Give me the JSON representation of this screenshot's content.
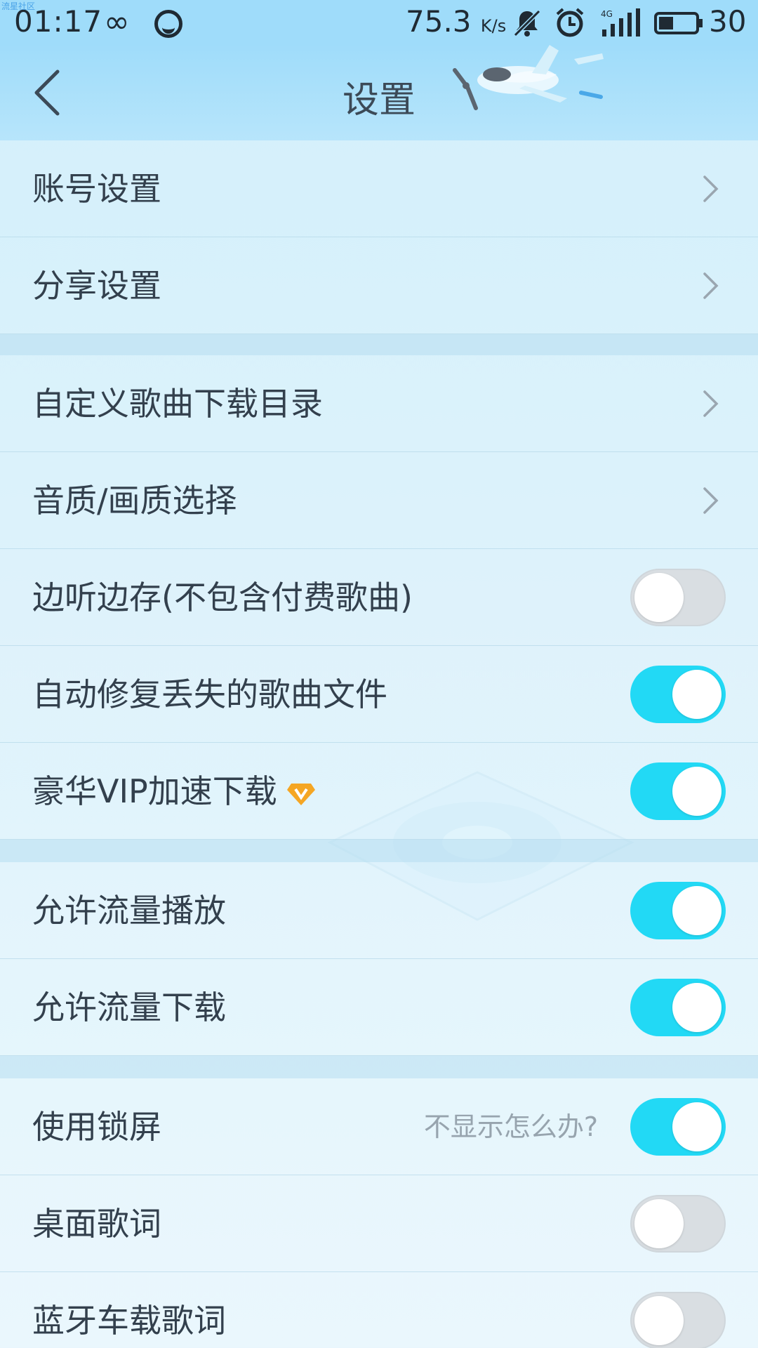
{
  "watermark": "流星社区",
  "status_bar": {
    "time": "01:17",
    "infinity": "∞",
    "speed": "75.3",
    "speed_unit": "K/s",
    "signal_type": "4G",
    "battery": "30"
  },
  "header": {
    "title": "设置",
    "back_icon": "chevron-left-icon",
    "decoration": "airplane-icon"
  },
  "settings": {
    "account": {
      "label": "账号设置",
      "icon": "chevron-right-icon"
    },
    "share": {
      "label": "分享设置",
      "icon": "chevron-right-icon"
    },
    "download_dir": {
      "label": "自定义歌曲下载目录",
      "icon": "chevron-right-icon"
    },
    "quality": {
      "label": "音质/画质选择",
      "icon": "chevron-right-icon"
    },
    "cache_while_listening": {
      "label": "边听边存(不包含付费歌曲)",
      "enabled": false
    },
    "auto_repair": {
      "label": "自动修复丢失的歌曲文件",
      "enabled": true
    },
    "vip_download": {
      "label": "豪华VIP加速下载",
      "badge": "vip-diamond-icon",
      "enabled": true
    },
    "data_playback": {
      "label": "允许流量播放",
      "enabled": true
    },
    "data_download": {
      "label": "允许流量下载",
      "enabled": true
    },
    "lock_screen": {
      "label": "使用锁屏",
      "hint": "不显示怎么办?",
      "enabled": true
    },
    "desktop_lyrics": {
      "label": "桌面歌词",
      "enabled": false
    },
    "bluetooth_lyrics": {
      "label": "蓝牙车载歌词",
      "enabled": false
    }
  },
  "colors": {
    "toggle_on": "#22d9f5",
    "toggle_off": "#d9dee2",
    "header_bg": "#9fdcfa",
    "vip_badge": "#f5a623"
  }
}
